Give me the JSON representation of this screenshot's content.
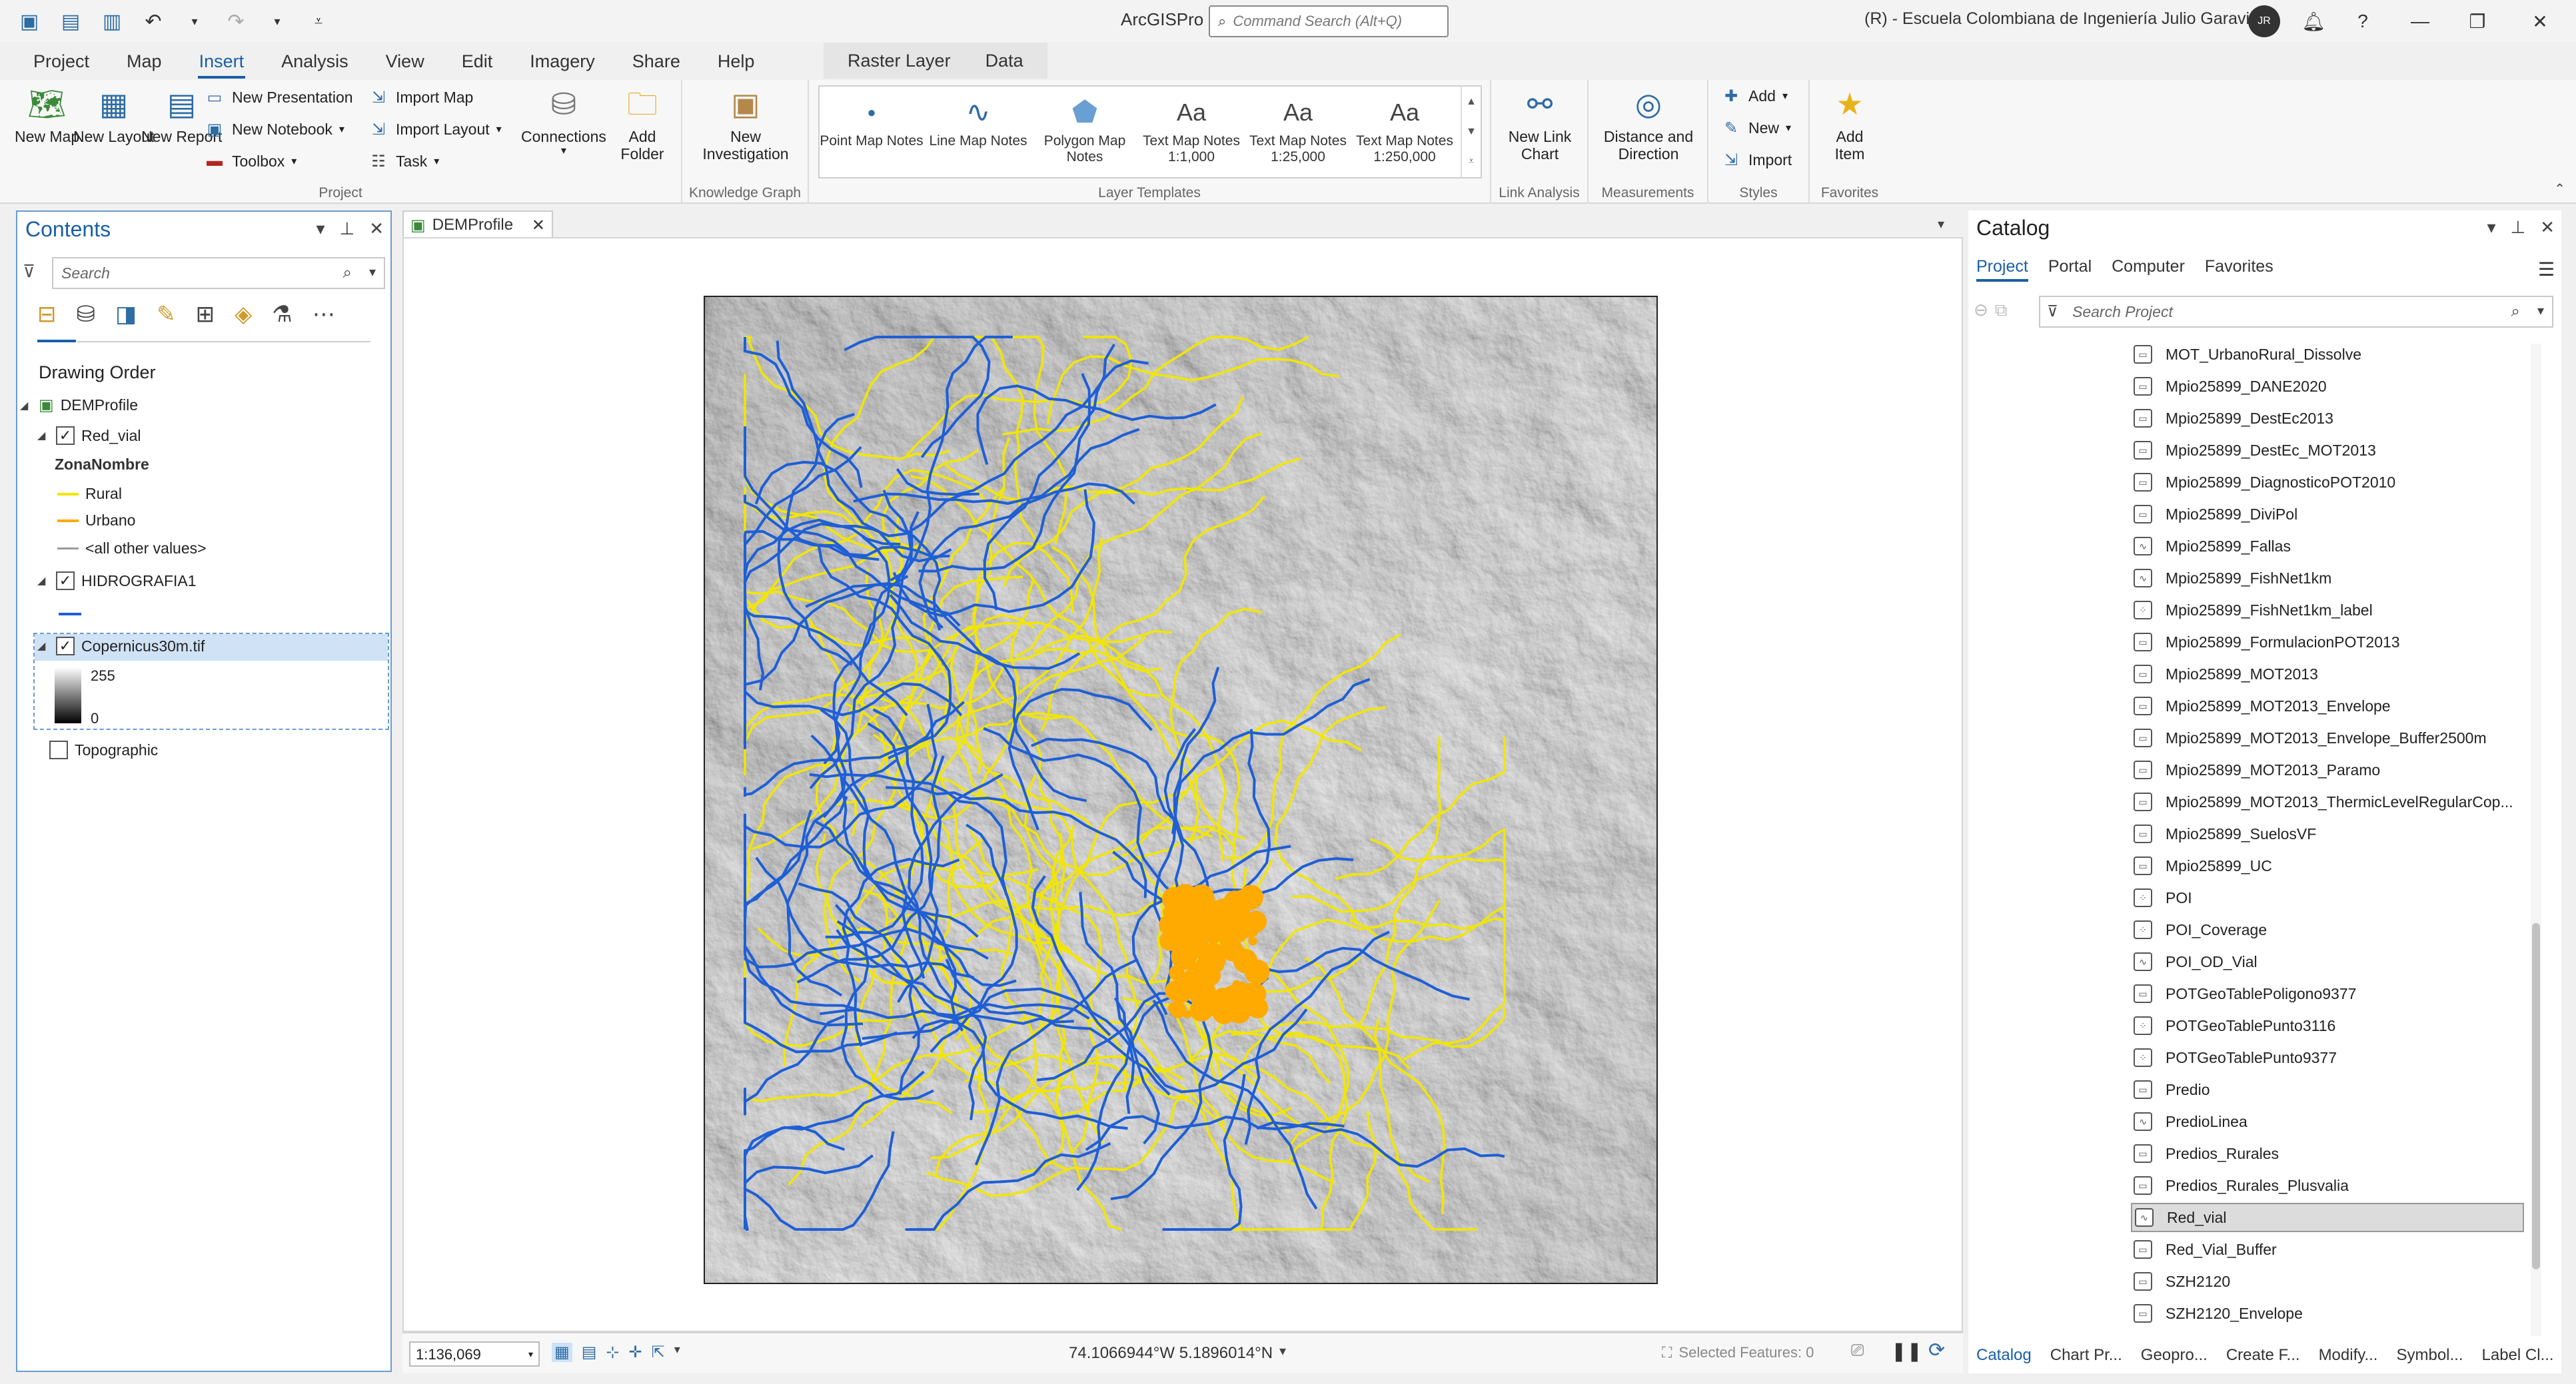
{
  "app": {
    "title": "ArcGISPro",
    "command_search_placeholder": "Command Search (Alt+Q)",
    "org": "(R) - Escuela Colombiana de Ingeniería Julio Garavito",
    "avatar_initials": "JR"
  },
  "ribbon": {
    "tabs": [
      "Project",
      "Map",
      "Insert",
      "Analysis",
      "View",
      "Edit",
      "Imagery",
      "Share",
      "Help"
    ],
    "active_tab": "Insert",
    "context_tabs": [
      "Raster Layer",
      "Data"
    ],
    "groups": {
      "project": {
        "label": "Project",
        "new_map": "New Map",
        "new_layout": "New Layout",
        "new_report": "New Report",
        "new_presentation": "New Presentation",
        "new_notebook": "New Notebook",
        "toolbox": "Toolbox",
        "import_map": "Import Map",
        "import_layout": "Import Layout",
        "task": "Task",
        "connections": "Connections",
        "add_folder": "Add Folder"
      },
      "knowledge_graph": {
        "label": "Knowledge Graph",
        "new_investigation": "New Investigation"
      },
      "layer_templates": {
        "label": "Layer Templates",
        "items": [
          "Point Map Notes",
          "Line Map Notes",
          "Polygon Map Notes",
          "Text Map Notes 1:1,000",
          "Text Map Notes 1:25,000",
          "Text Map Notes 1:250,000"
        ]
      },
      "link_analysis": {
        "label": "Link Analysis",
        "new_link_chart": "New Link Chart"
      },
      "measurements": {
        "label": "Measurements",
        "distance_direction": "Distance and Direction"
      },
      "styles": {
        "label": "Styles",
        "add": "Add",
        "new": "New",
        "import": "Import"
      },
      "favorites": {
        "label": "Favorites",
        "add_item": "Add Item"
      }
    }
  },
  "contents": {
    "title": "Contents",
    "search_placeholder": "Search",
    "drawing_order": "Drawing Order",
    "map_name": "DEMProfile",
    "layers": {
      "red_vial": "Red_vial",
      "field": "ZonaNombre",
      "rural": "Rural",
      "urbano": "Urbano",
      "other": "<all other values>",
      "hidrografia": "HIDROGRAFIA1",
      "raster": "Copernicus30m.tif",
      "raster_high": "255",
      "raster_low": "0",
      "basemap": "Topographic"
    }
  },
  "map": {
    "tab_label": "DEMProfile",
    "scale": "1:136,069",
    "coordinates": "74.1066944°W 5.1896014°N",
    "selected_features": "Selected Features: 0"
  },
  "catalog": {
    "title": "Catalog",
    "tabs": [
      "Project",
      "Portal",
      "Computer",
      "Favorites"
    ],
    "active_tab": "Project",
    "search_placeholder": "Search Project",
    "items": [
      {
        "name": "MOT_UrbanoRural_Dissolve",
        "icon": "polygon-feature-icon"
      },
      {
        "name": "Mpio25899_DANE2020",
        "icon": "polygon-feature-icon"
      },
      {
        "name": "Mpio25899_DestEc2013",
        "icon": "polygon-feature-icon"
      },
      {
        "name": "Mpio25899_DestEc_MOT2013",
        "icon": "polygon-feature-icon"
      },
      {
        "name": "Mpio25899_DiagnosticoPOT2010",
        "icon": "polygon-feature-icon"
      },
      {
        "name": "Mpio25899_DiviPol",
        "icon": "polygon-feature-icon"
      },
      {
        "name": "Mpio25899_Fallas",
        "icon": "line-feature-icon"
      },
      {
        "name": "Mpio25899_FishNet1km",
        "icon": "line-feature-icon"
      },
      {
        "name": "Mpio25899_FishNet1km_label",
        "icon": "point-feature-icon"
      },
      {
        "name": "Mpio25899_FormulacionPOT2013",
        "icon": "polygon-feature-icon"
      },
      {
        "name": "Mpio25899_MOT2013",
        "icon": "polygon-feature-icon"
      },
      {
        "name": "Mpio25899_MOT2013_Envelope",
        "icon": "polygon-feature-icon"
      },
      {
        "name": "Mpio25899_MOT2013_Envelope_Buffer2500m",
        "icon": "polygon-feature-icon"
      },
      {
        "name": "Mpio25899_MOT2013_Paramo",
        "icon": "polygon-feature-icon"
      },
      {
        "name": "Mpio25899_MOT2013_ThermicLevelRegularCop...",
        "icon": "polygon-feature-icon"
      },
      {
        "name": "Mpio25899_SuelosVF",
        "icon": "polygon-feature-icon"
      },
      {
        "name": "Mpio25899_UC",
        "icon": "polygon-feature-icon"
      },
      {
        "name": "POI",
        "icon": "point-feature-icon"
      },
      {
        "name": "POI_Coverage",
        "icon": "point-feature-icon"
      },
      {
        "name": "POI_OD_Vial",
        "icon": "line-feature-icon"
      },
      {
        "name": "POTGeoTablePoligono9377",
        "icon": "polygon-feature-icon"
      },
      {
        "name": "POTGeoTablePunto3116",
        "icon": "point-feature-icon"
      },
      {
        "name": "POTGeoTablePunto9377",
        "icon": "point-feature-icon"
      },
      {
        "name": "Predio",
        "icon": "polygon-feature-icon"
      },
      {
        "name": "PredioLinea",
        "icon": "line-feature-icon"
      },
      {
        "name": "Predios_Rurales",
        "icon": "polygon-feature-icon"
      },
      {
        "name": "Predios_Rurales_Plusvalia",
        "icon": "polygon-feature-icon"
      },
      {
        "name": "Red_vial",
        "icon": "line-feature-icon",
        "selected": true
      },
      {
        "name": "Red_Vial_Buffer",
        "icon": "polygon-feature-icon"
      },
      {
        "name": "SZH2120",
        "icon": "polygon-feature-icon"
      },
      {
        "name": "SZH2120_Envelope",
        "icon": "polygon-feature-icon"
      }
    ],
    "bottom_tabs": [
      "Catalog",
      "Chart Pr...",
      "Geopro...",
      "Create F...",
      "Modify...",
      "Symbol...",
      "Label Cl..."
    ]
  },
  "colors": {
    "accent": "#1a5fa8",
    "rural_line": "#f2e600",
    "urbano_line": "#ffaa00",
    "hydro_line": "#1f5fd6"
  }
}
